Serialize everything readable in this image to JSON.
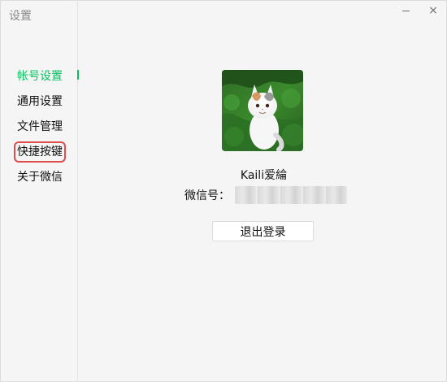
{
  "window": {
    "title": "设置",
    "minimize_symbol": "—",
    "close_symbol": "×"
  },
  "sidebar": {
    "items": [
      {
        "label": "帐号设置",
        "state": "active"
      },
      {
        "label": "通用设置"
      },
      {
        "label": "文件管理"
      },
      {
        "label": "快捷按键",
        "state": "highlighted"
      },
      {
        "label": "关于微信"
      }
    ]
  },
  "profile": {
    "nickname": "Kaili爱綸",
    "wechat_id_label": "微信号：",
    "wechat_id_value": ""
  },
  "actions": {
    "logout_label": "退出登录"
  },
  "colors": {
    "accent": "#07c160",
    "highlight_border": "#e04b4b",
    "background": "#f5f5f5"
  },
  "icons": {
    "minimize": "minimize-icon",
    "close": "close-icon"
  }
}
